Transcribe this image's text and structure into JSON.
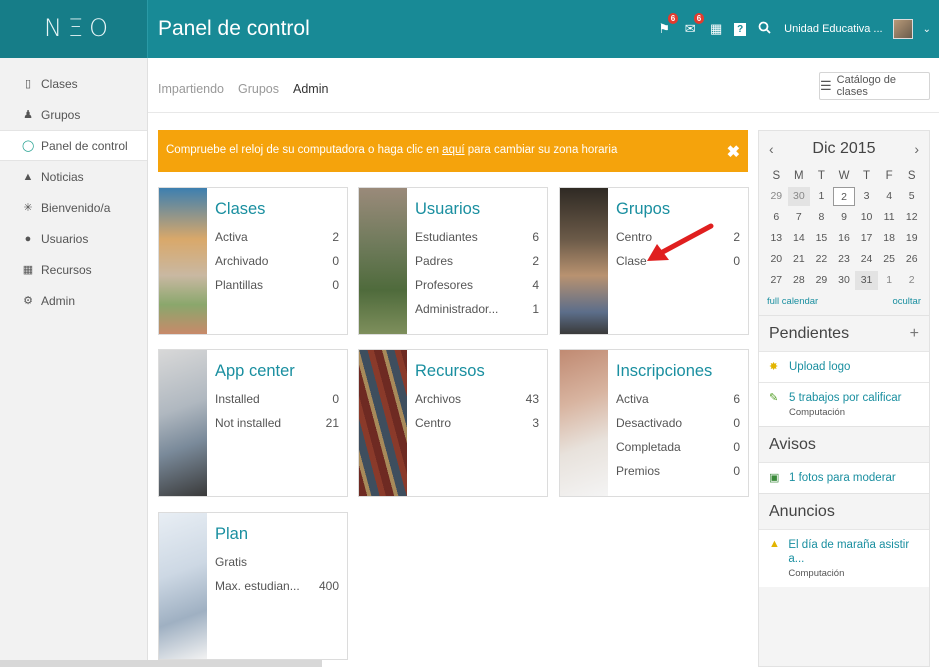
{
  "app": {
    "logo": "NΞO",
    "page_title": "Panel de control",
    "org_name": "Unidad Educativa ...",
    "badges": {
      "notifications": "6",
      "messages": "6"
    }
  },
  "sidebar": {
    "items": [
      {
        "label": "Clases",
        "icon": "tablet-icon"
      },
      {
        "label": "Grupos",
        "icon": "people-icon"
      },
      {
        "label": "Panel de control",
        "icon": "dashboard-icon",
        "active": true
      },
      {
        "label": "Noticias",
        "icon": "megaphone-icon"
      },
      {
        "label": "Bienvenido/a",
        "icon": "sparkle-icon"
      },
      {
        "label": "Usuarios",
        "icon": "user-icon"
      },
      {
        "label": "Recursos",
        "icon": "books-icon"
      },
      {
        "label": "Admin",
        "icon": "gear-icon"
      }
    ]
  },
  "subnav": {
    "tabs": [
      "Impartiendo",
      "Grupos",
      "Admin"
    ],
    "selected": "Admin"
  },
  "catalog_button": "Catálogo de clases",
  "banner": {
    "text_before": "Compruebe el reloj de su computadora o haga clic en ",
    "link": "aquí",
    "text_after": " para cambiar su zona horaria",
    "close": "✖"
  },
  "cards": {
    "clases": {
      "title": "Clases",
      "rows": [
        [
          "Activa",
          "2"
        ],
        [
          "Archivado",
          "0"
        ],
        [
          "Plantillas",
          "0"
        ]
      ]
    },
    "usuarios": {
      "title": "Usuarios",
      "rows": [
        [
          "Estudiantes",
          "6"
        ],
        [
          "Padres",
          "2"
        ],
        [
          "Profesores",
          "4"
        ],
        [
          "Administrador...",
          "1"
        ]
      ]
    },
    "grupos": {
      "title": "Grupos",
      "rows": [
        [
          "Centro",
          "2"
        ],
        [
          "Clase",
          "0"
        ]
      ]
    },
    "app_center": {
      "title": "App center",
      "rows": [
        [
          "Installed",
          "0"
        ],
        [
          "Not installed",
          "21"
        ]
      ]
    },
    "recursos": {
      "title": "Recursos",
      "rows": [
        [
          "Archivos",
          "43"
        ],
        [
          "Centro",
          "3"
        ]
      ]
    },
    "inscripciones": {
      "title": "Inscripciones",
      "rows": [
        [
          "Activa",
          "6"
        ],
        [
          "Desactivado",
          "0"
        ],
        [
          "Completada",
          "0"
        ],
        [
          "Premios",
          "0"
        ]
      ]
    },
    "plan": {
      "title": "Plan",
      "rows": [
        [
          "Gratis",
          ""
        ],
        [
          "Max. estudian...",
          "400"
        ]
      ]
    }
  },
  "calendar": {
    "month": "Dic 2015",
    "prev": "‹",
    "next": "›",
    "dow": [
      "S",
      "M",
      "T",
      "W",
      "T",
      "F",
      "S"
    ],
    "weeks": [
      [
        "29",
        "30",
        "1",
        "2",
        "3",
        "4",
        "5"
      ],
      [
        "6",
        "7",
        "8",
        "9",
        "10",
        "11",
        "12"
      ],
      [
        "13",
        "14",
        "15",
        "16",
        "17",
        "18",
        "19"
      ],
      [
        "20",
        "21",
        "22",
        "23",
        "24",
        "25",
        "26"
      ],
      [
        "27",
        "28",
        "29",
        "30",
        "31",
        "1",
        "2"
      ]
    ],
    "full_calendar": "full calendar",
    "hide": "ocultar"
  },
  "pendientes": {
    "title": "Pendientes",
    "add": "+",
    "items": [
      {
        "text": "Upload logo",
        "sub": ""
      },
      {
        "text": "5 trabajos por calificar",
        "sub": "Computación"
      }
    ]
  },
  "avisos": {
    "title": "Avisos",
    "items": [
      {
        "text": "1 fotos para moderar"
      }
    ]
  },
  "anuncios": {
    "title": "Anuncios",
    "items": [
      {
        "text": "El día de maraña asistir a...",
        "sub": "Computación"
      }
    ]
  }
}
